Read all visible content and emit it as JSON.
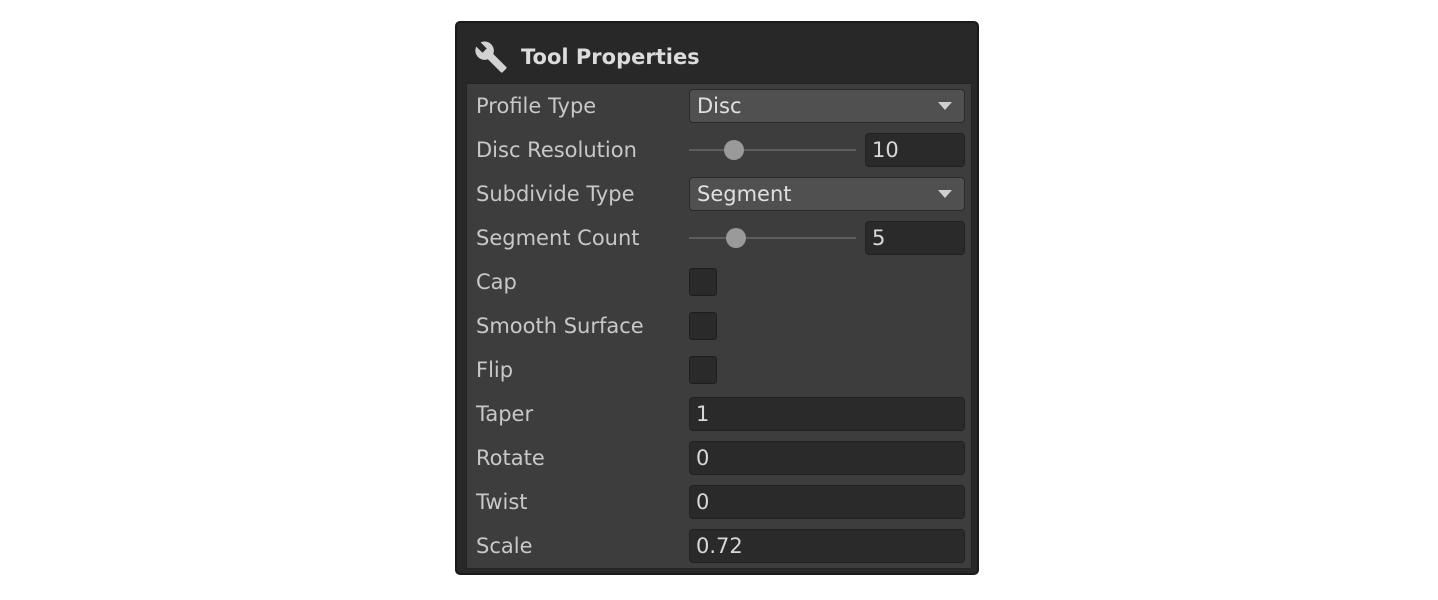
{
  "panel": {
    "title": "Tool Properties",
    "icon": "wrench-icon"
  },
  "profile_type": {
    "label": "Profile Type",
    "value": "Disc"
  },
  "disc_resolution": {
    "label": "Disc Resolution",
    "value": "10",
    "slider_fraction": 0.27
  },
  "subdivide_type": {
    "label": "Subdivide Type",
    "value": "Segment"
  },
  "segment_count": {
    "label": "Segment Count",
    "value": "5",
    "slider_fraction": 0.28
  },
  "cap": {
    "label": "Cap",
    "checked": false
  },
  "smooth_surface": {
    "label": "Smooth Surface",
    "checked": false
  },
  "flip": {
    "label": "Flip",
    "checked": false
  },
  "taper": {
    "label": "Taper",
    "value": "1"
  },
  "rotate": {
    "label": "Rotate",
    "value": "0"
  },
  "twist": {
    "label": "Twist",
    "value": "0"
  },
  "scale": {
    "label": "Scale",
    "value": "0.72"
  },
  "colors": {
    "panel_bg": "#3d3d3d",
    "header_bg": "#282828",
    "field_bg": "#2a2a2a",
    "dropdown_bg": "#505050",
    "label_text": "#c8c8c8"
  }
}
